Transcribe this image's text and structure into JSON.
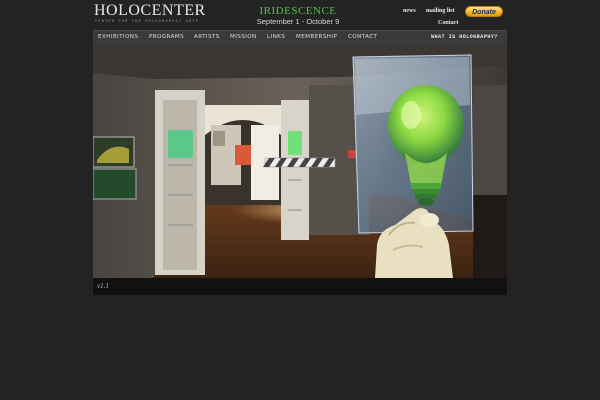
{
  "header": {
    "logo": "HOLOCENTER",
    "tagline": "CENTER FOR THE HOLOGRAPHIC ARTS",
    "promo_title": "IRIDESCENCE",
    "promo_dates": "September 1 - October 9"
  },
  "utility_nav": {
    "news": "news",
    "mailing_list": "mailing list",
    "contact": "Contact",
    "donate": "Donate"
  },
  "nav": {
    "items": [
      {
        "label": "EXHIBITIONS"
      },
      {
        "label": "PROGRAMS"
      },
      {
        "label": "ARTISTS"
      },
      {
        "label": "MISSION"
      },
      {
        "label": "LINKS"
      },
      {
        "label": "MEMBERSHIP"
      },
      {
        "label": "CONTACT"
      }
    ],
    "what_is": "WHAT IS HOLOGRAPHY?"
  },
  "hero": {
    "icon": "gallery-hologram-lightbulb-image",
    "caption": "v1.1"
  },
  "colors": {
    "background": "#232323",
    "nav_bg": "#3a3a3a",
    "promo_green": "#4ec04e",
    "donate_gold": "#f6b62b"
  }
}
